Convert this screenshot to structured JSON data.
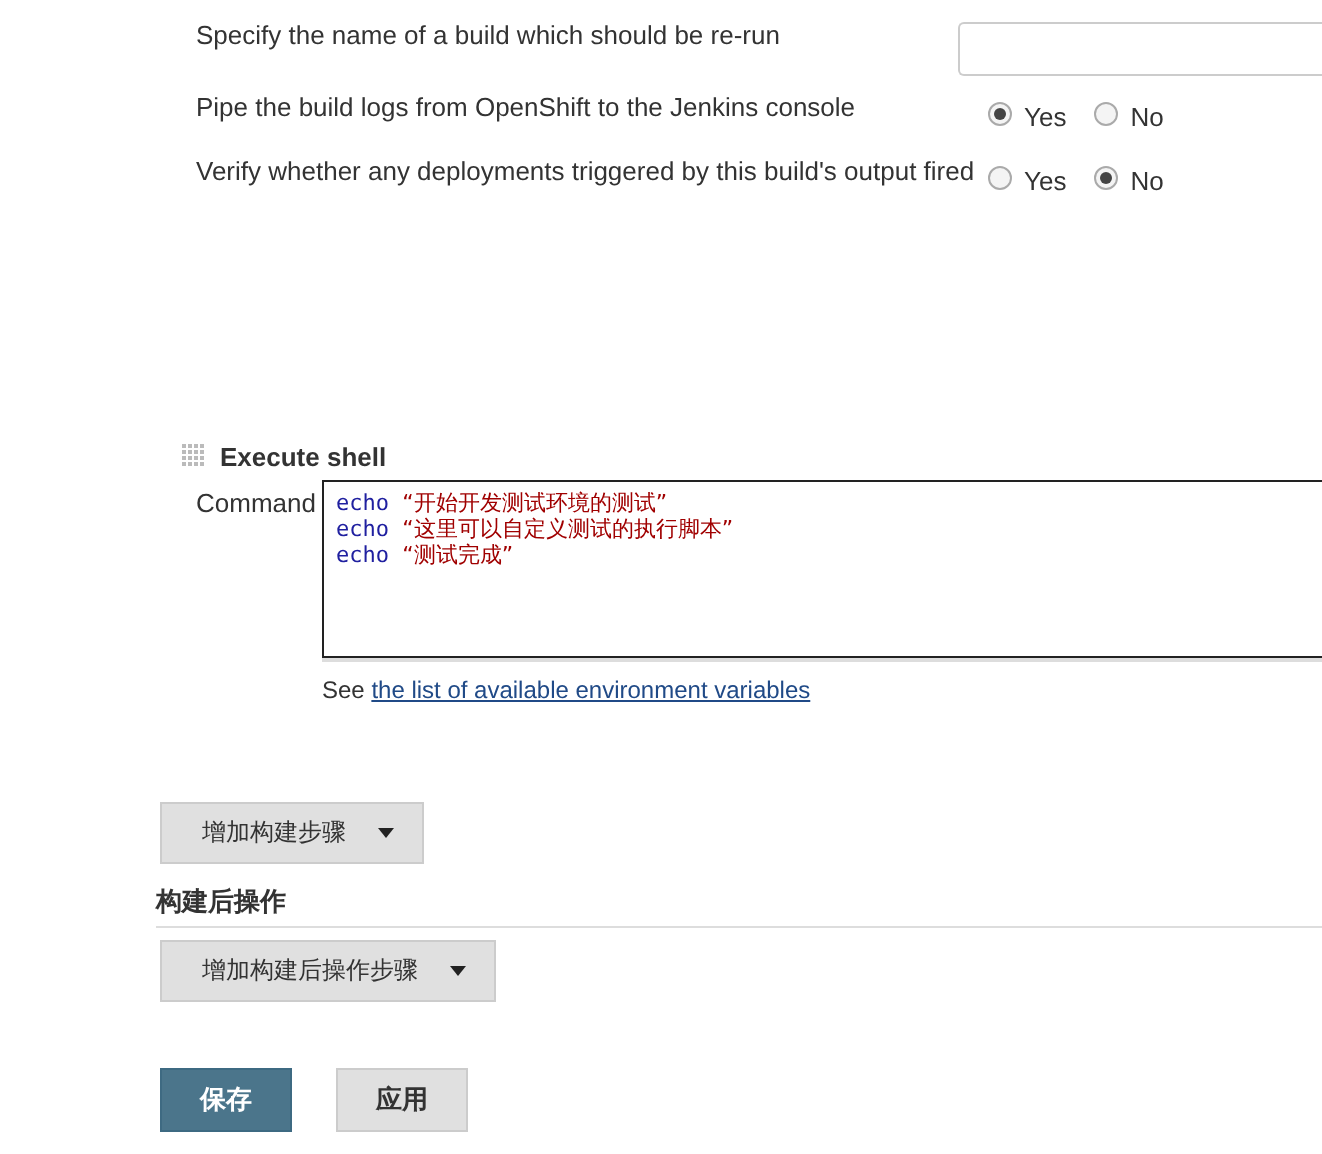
{
  "settings": [
    {
      "kind": "text",
      "label": "Specify the name of a build which should be re-run"
    },
    {
      "kind": "radio",
      "label": "Pipe the build logs from OpenShift to the Jenkins console",
      "options": [
        {
          "label": "Yes",
          "selected": true
        },
        {
          "label": "No",
          "selected": false
        }
      ]
    },
    {
      "kind": "radio",
      "label": "Verify whether any deployments triggered by this build's output fired",
      "options": [
        {
          "label": "Yes",
          "selected": false
        },
        {
          "label": "No",
          "selected": true
        }
      ]
    }
  ],
  "build_step": {
    "title": "Execute shell",
    "command_label": "Command",
    "command_lines": [
      {
        "keyword": "echo",
        "argument": "“开始开发测试环境的测试”"
      },
      {
        "keyword": "echo",
        "argument": "“这里可以自定义测试的执行脚本”"
      },
      {
        "keyword": "echo",
        "argument": "“测试完成”"
      }
    ],
    "hint_prefix": "See ",
    "hint_link": "the list of available environment variables"
  },
  "add_build_step": "增加构建步骤",
  "post_build": {
    "title": "构建后操作",
    "add_button": "增加构建后操作步骤"
  },
  "actions": [
    {
      "label": "保存",
      "primary": true
    },
    {
      "label": "应用",
      "primary": false
    }
  ]
}
